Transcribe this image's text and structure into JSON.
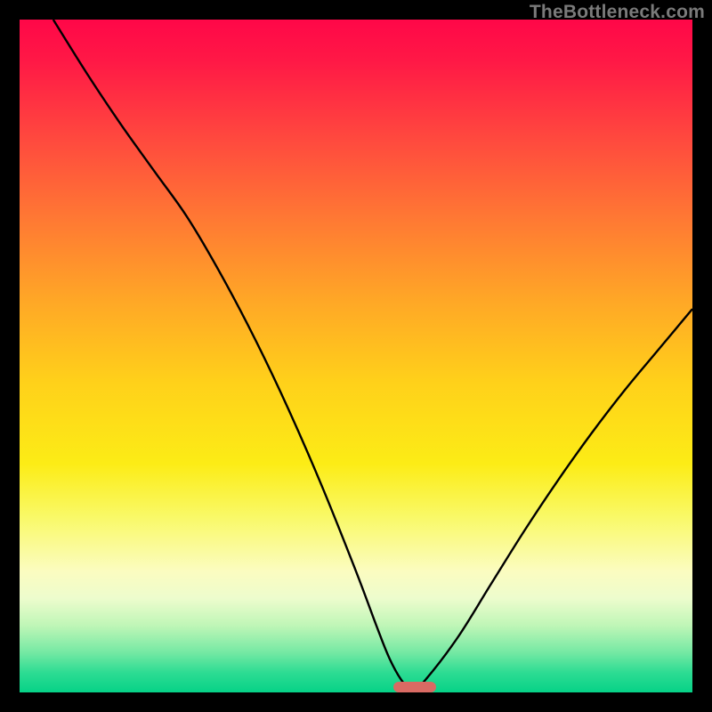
{
  "watermark": "TheBottleneck.com",
  "colors": {
    "frame": "#000000",
    "curve": "#000000",
    "marker": "#d96a63",
    "gradient_top": "#ff0748",
    "gradient_bottom": "#06d287"
  },
  "chart_data": {
    "type": "line",
    "title": "",
    "xlabel": "",
    "ylabel": "",
    "xlim": [
      0,
      100
    ],
    "ylim": [
      0,
      100
    ],
    "grid": false,
    "legend": false,
    "series": [
      {
        "name": "curve",
        "x": [
          5,
          10,
          15,
          20,
          25,
          30,
          35,
          40,
          45,
          50,
          53,
          55,
          57,
          58.5,
          60,
          65,
          70,
          75,
          80,
          85,
          90,
          95,
          100
        ],
        "y": [
          100,
          92,
          84.5,
          77.5,
          70.5,
          62,
          52.5,
          42,
          30.5,
          18,
          10,
          5,
          1.5,
          0.5,
          1.5,
          8,
          16,
          24,
          31.5,
          38.5,
          45,
          51,
          57
        ]
      }
    ],
    "marker": {
      "x_center": 58.7,
      "y": 0,
      "width_pct": 6.3,
      "height_pct": 1.6
    }
  }
}
